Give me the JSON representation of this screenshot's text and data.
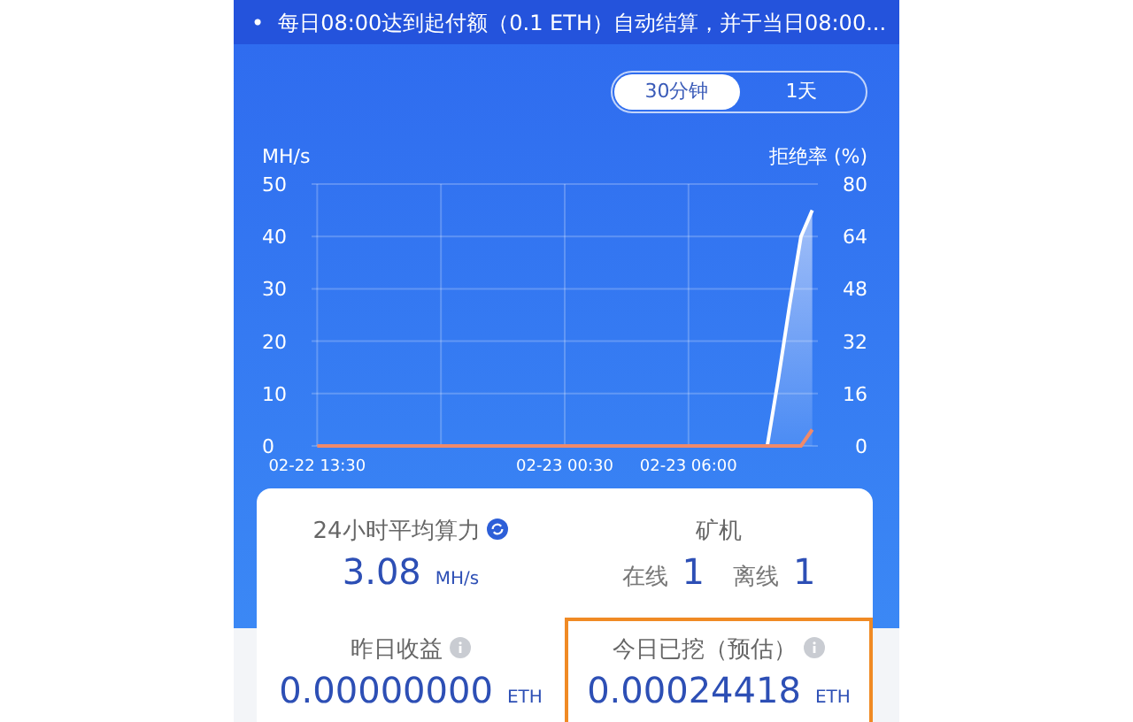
{
  "notice": {
    "bullet": "•",
    "text": "每日08:00达到起付额（0.1 ETH）自动结算，并于当日08:00..."
  },
  "range_toggle": [
    {
      "label": "30分钟",
      "selected": true
    },
    {
      "label": "1天",
      "selected": false
    }
  ],
  "chart_data": {
    "type": "area",
    "grid": true,
    "ylabel": "MH/s",
    "y2label": "拒绝率 (%)",
    "ylim": [
      0,
      50
    ],
    "y2lim": [
      0,
      80
    ],
    "categories": [
      "02-22 13:30",
      null,
      null,
      null,
      null,
      null,
      null,
      null,
      null,
      null,
      null,
      null,
      null,
      null,
      null,
      null,
      null,
      null,
      null,
      null,
      null,
      null,
      "02-23 00:30",
      null,
      null,
      null,
      null,
      null,
      null,
      null,
      null,
      null,
      null,
      "02-23 06:00",
      null,
      null,
      null,
      null,
      null,
      null,
      null,
      null,
      null,
      null,
      null
    ],
    "yticks": [
      0,
      10,
      20,
      30,
      40,
      50
    ],
    "y2ticks": [
      0,
      16,
      32,
      48,
      64,
      80
    ],
    "series": [
      {
        "color": "#ffffff",
        "values": [
          null,
          null,
          null,
          null,
          null,
          null,
          null,
          null,
          null,
          null,
          null,
          null,
          null,
          null,
          null,
          null,
          null,
          null,
          null,
          null,
          null,
          null,
          null,
          null,
          null,
          null,
          null,
          null,
          null,
          null,
          null,
          null,
          null,
          null,
          null,
          null,
          null,
          null,
          null,
          null,
          0,
          13,
          27,
          40,
          45
        ]
      },
      {
        "type": "line",
        "color": "#f08a6a",
        "axis": "y2",
        "values": [
          0,
          0,
          0,
          0,
          0,
          0,
          0,
          0,
          0,
          0,
          0,
          0,
          0,
          0,
          0,
          0,
          0,
          0,
          0,
          0,
          0,
          0,
          0,
          0,
          0,
          0,
          0,
          0,
          0,
          0,
          0,
          0,
          0,
          0,
          0,
          0,
          0,
          0,
          0,
          0,
          0,
          0,
          0,
          0,
          5
        ]
      }
    ]
  },
  "stats": [
    {
      "kind": "rate",
      "title": "24小时平均算力",
      "value": "3.08",
      "unit": "MH/s",
      "highlighted": false
    },
    {
      "kind": "miners",
      "title": "矿机",
      "online_label": "在线",
      "online": "1",
      "offline_label": "离线",
      "offline": "1",
      "highlighted": false
    },
    {
      "kind": "earning",
      "title": "昨日收益",
      "value": "0.00000000",
      "unit": "ETH",
      "highlighted": false
    },
    {
      "kind": "earning",
      "title": "今日已挖（预估）",
      "value": "0.00024418",
      "unit": "ETH",
      "highlighted": true
    }
  ]
}
